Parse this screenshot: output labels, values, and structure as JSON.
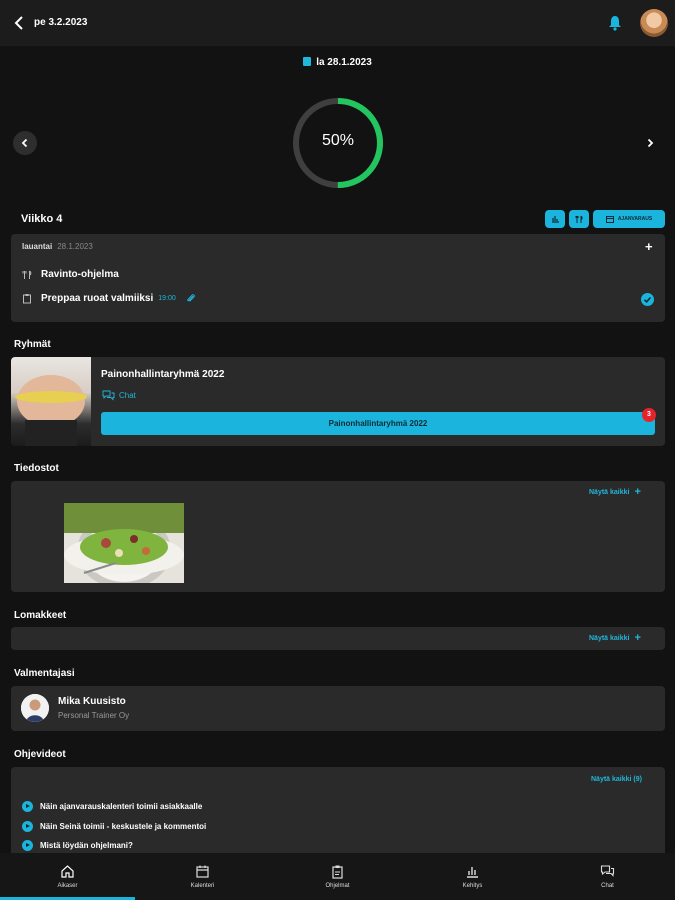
{
  "header": {
    "date": "pe 3.2.2023"
  },
  "day": {
    "date": "la 28.1.2023",
    "progress_label": "50%",
    "progress": 0.5
  },
  "week": {
    "title": "Viikko 4",
    "booking_label": "AJANVARAUS"
  },
  "day_card": {
    "weekday": "lauantai",
    "date": "28.1.2023",
    "items": [
      {
        "label": "Ravinto-ohjelma",
        "time": ""
      },
      {
        "label": "Preppaa ruoat valmiiksi",
        "time": "19:00"
      }
    ]
  },
  "groups": {
    "title": "Ryhmät",
    "name": "Painonhallintaryhmä 2022",
    "chat_label": "Chat",
    "button_label": "Painonhallintaryhmä 2022",
    "badge": "3"
  },
  "files": {
    "title": "Tiedostot",
    "show_all": "Näytä kaikki"
  },
  "forms": {
    "title": "Lomakkeet",
    "show_all": "Näytä kaikki"
  },
  "coaches": {
    "title": "Valmentajasi",
    "name": "Mika Kuusisto",
    "company": "Personal Trainer Oy"
  },
  "videos": {
    "title": "Ohjevideot",
    "show_all": "Näytä kaikki (9)",
    "items": [
      "Näin ajanvarauskalenteri toimii asiakkaalle",
      "Näin Seinä toimii - keskustele ja kommentoi",
      "Mistä löydän ohjelmani?"
    ]
  },
  "nav": {
    "tabs": [
      "Aikaser",
      "Kalenteri",
      "Ohjelmat",
      "Kehitys",
      "Chat"
    ]
  },
  "colors": {
    "accent": "#1ab4dc",
    "progress": "#22c55e",
    "badge": "#e6222a"
  }
}
